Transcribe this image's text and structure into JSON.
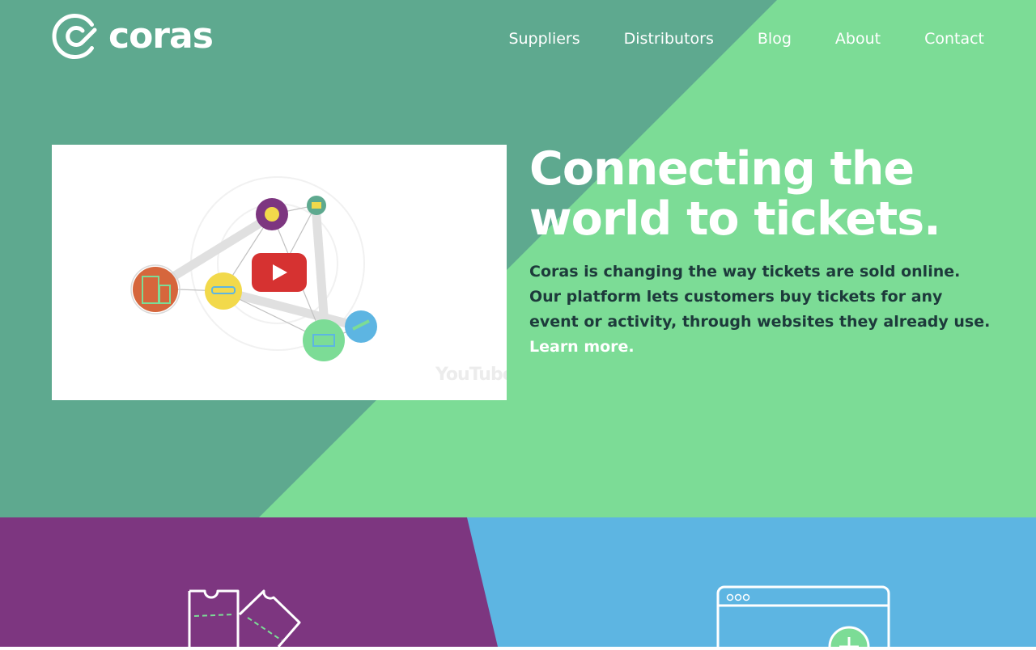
{
  "brand": {
    "name": "coras"
  },
  "nav": [
    {
      "label": "Suppliers"
    },
    {
      "label": "Distributors"
    },
    {
      "label": "Blog"
    },
    {
      "label": "About"
    },
    {
      "label": "Contact"
    }
  ],
  "hero": {
    "headline_line1": "Connecting the",
    "headline_line2": "world to tickets.",
    "description": "Coras is changing the way tickets are sold online. Our platform lets customers buy tickets for any event or activity, through websites they already use. ",
    "learn_more": "Learn more.",
    "video": {
      "watermark": "YouTube"
    }
  },
  "colors": {
    "hero_dark": "#5ea98f",
    "hero_light": "#7cdc96",
    "purple": "#7d3680",
    "blue": "#5db5e2",
    "play_red": "#d63231"
  },
  "icons": [
    "coras-logo-icon",
    "play-icon",
    "tickets-icon",
    "browser-icon",
    "plus-icon"
  ]
}
